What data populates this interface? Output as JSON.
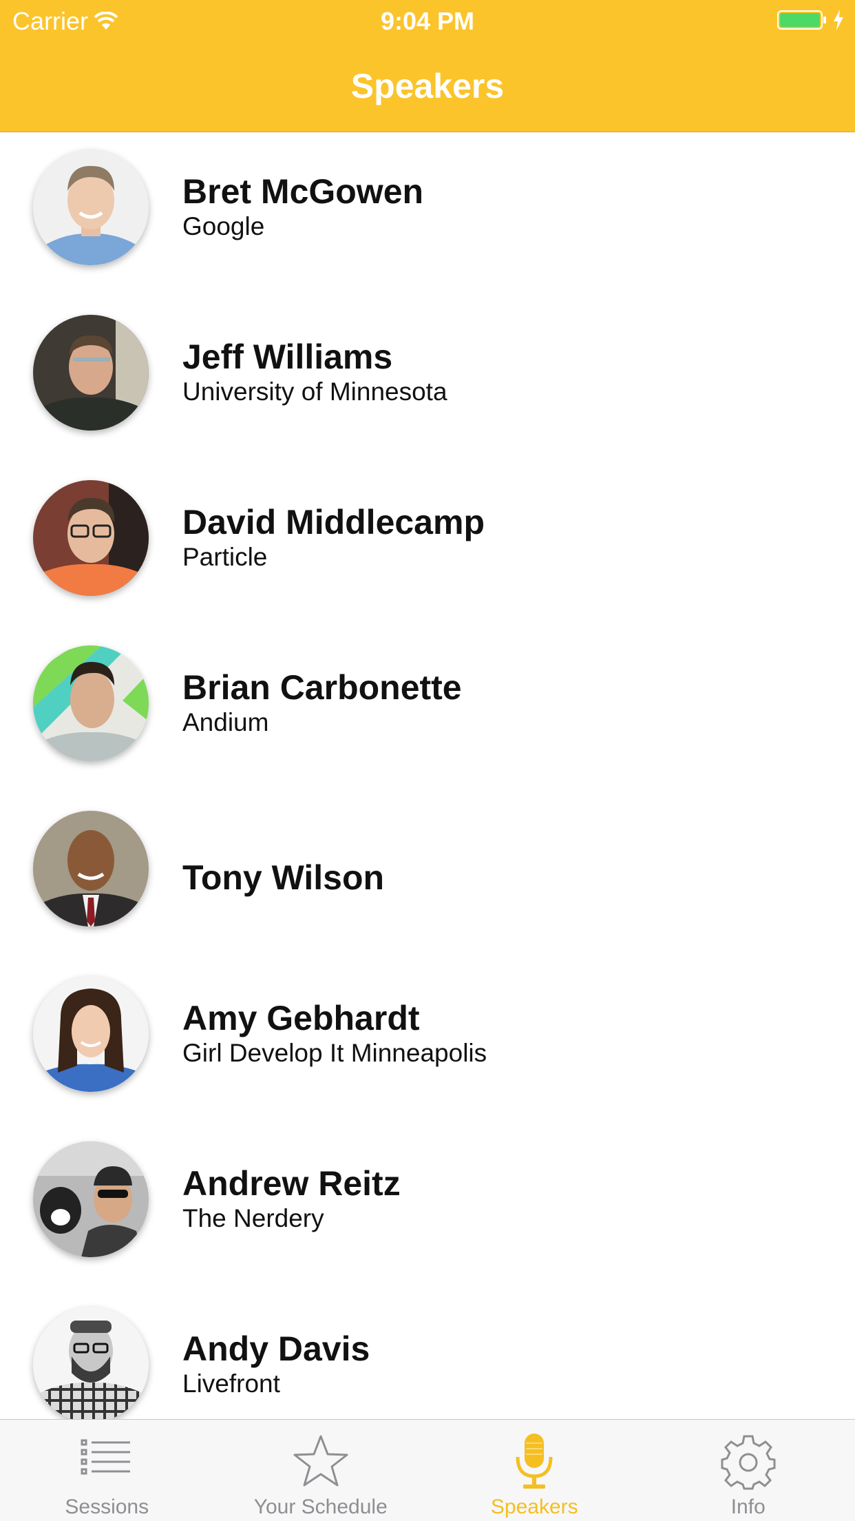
{
  "status_bar": {
    "carrier": "Carrier",
    "time": "9:04 PM"
  },
  "nav": {
    "title": "Speakers"
  },
  "speakers": [
    {
      "name": "Bret McGowen",
      "org": "Google"
    },
    {
      "name": "Jeff Williams",
      "org": "University of Minnesota"
    },
    {
      "name": "David Middlecamp",
      "org": "Particle"
    },
    {
      "name": "Brian Carbonette",
      "org": "Andium"
    },
    {
      "name": "Tony Wilson",
      "org": ""
    },
    {
      "name": "Amy Gebhardt",
      "org": "Girl Develop It Minneapolis"
    },
    {
      "name": "Andrew Reitz",
      "org": "The Nerdery"
    },
    {
      "name": "Andy Davis",
      "org": "Livefront"
    }
  ],
  "tabs": [
    {
      "label": "Sessions",
      "icon": "list-icon"
    },
    {
      "label": "Your Schedule",
      "icon": "star-icon"
    },
    {
      "label": "Speakers",
      "icon": "microphone-icon",
      "active": true
    },
    {
      "label": "Info",
      "icon": "gear-icon"
    }
  ],
  "colors": {
    "accent": "#fbc42b",
    "tab_active": "#f5bf22",
    "tab_inactive": "#8e8e93"
  }
}
